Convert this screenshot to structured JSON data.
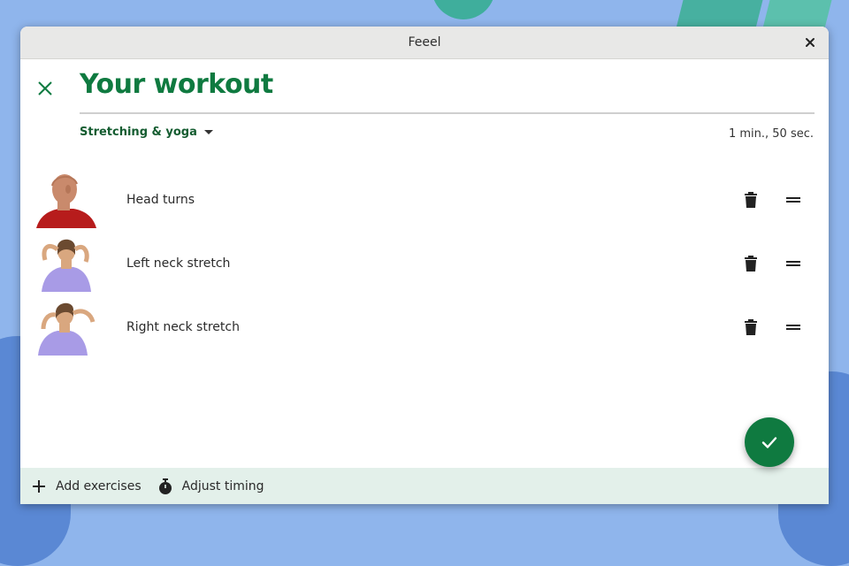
{
  "window": {
    "title": "Feeel"
  },
  "page": {
    "heading": "Your workout",
    "category": "Stretching & yoga",
    "duration": "1 min., 50 sec."
  },
  "exercises": [
    {
      "name": "Head turns",
      "thumb_icon": "man-head-turn-photo",
      "shirt_color": "#b71c1c"
    },
    {
      "name": "Left neck stretch",
      "thumb_icon": "woman-neck-stretch-photo",
      "shirt_color": "#a89be6"
    },
    {
      "name": "Right neck stretch",
      "thumb_icon": "woman-neck-stretch-photo",
      "shirt_color": "#a89be6"
    }
  ],
  "bottom_bar": {
    "add_label": "Add exercises",
    "timing_label": "Adjust timing"
  },
  "icons": {
    "close": "close-icon",
    "back": "x-icon",
    "trash": "trash-icon",
    "drag": "drag-handle-icon",
    "plus": "plus-icon",
    "timer": "stopwatch-icon",
    "confirm": "check-icon"
  },
  "colors": {
    "accent": "#0f7a40",
    "bottom_bar_bg": "#e3f0ea",
    "titlebar_bg": "#e8e8e7"
  }
}
